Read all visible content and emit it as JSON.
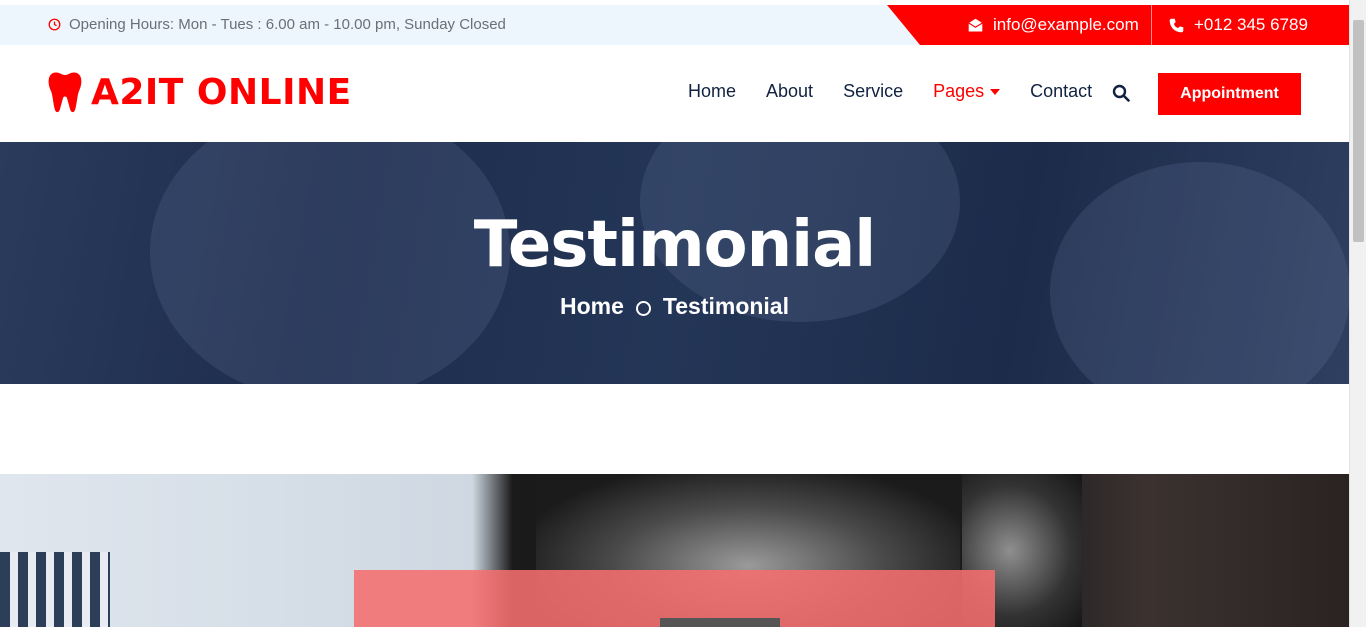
{
  "topbar": {
    "hours": "Opening Hours: Mon - Tues : 6.00 am - 10.00 pm, Sunday Closed",
    "email": "info@example.com",
    "phone": "+012 345 6789"
  },
  "brand": {
    "name": "A2IT ONLINE",
    "icon": "tooth-icon"
  },
  "nav": {
    "items": [
      {
        "label": "Home"
      },
      {
        "label": "About"
      },
      {
        "label": "Service"
      },
      {
        "label": "Pages"
      },
      {
        "label": "Contact"
      }
    ],
    "active": "Pages",
    "appointment_label": "Appointment"
  },
  "hero": {
    "title": "Testimonial",
    "breadcrumb": [
      "Home",
      "Testimonial"
    ]
  },
  "colors": {
    "accent": "#ff0000",
    "nav_text": "#112240",
    "hero_overlay": "#1d2c4c"
  }
}
